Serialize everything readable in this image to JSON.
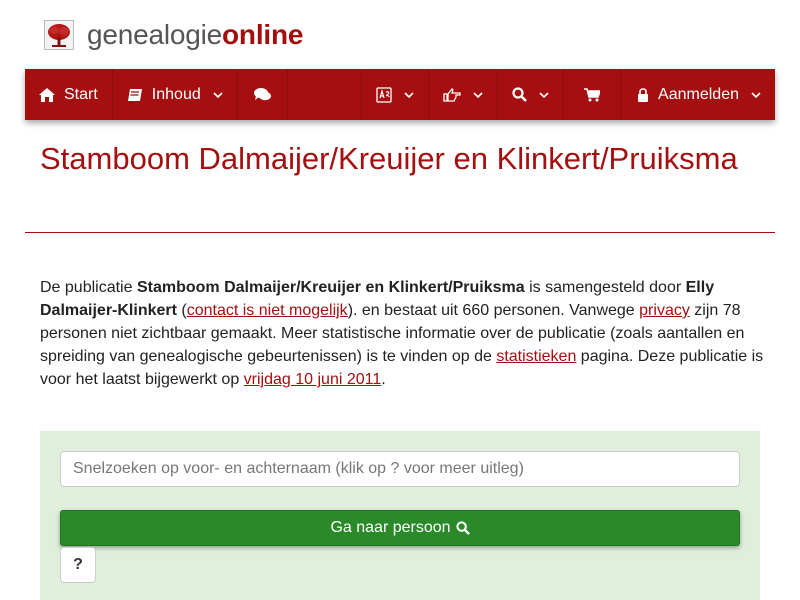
{
  "header": {
    "logo_icon": "tree-icon",
    "logo_text_plain": "genealogie",
    "logo_text_bold": "online"
  },
  "nav": {
    "start_label": "Start",
    "inhoud_label": "Inhoud",
    "login_label": "Aanmelden",
    "icons": [
      "home-icon",
      "book-icon",
      "comments-icon",
      "language-icon",
      "hand-point-icon",
      "search-icon",
      "cart-icon",
      "lock-icon",
      "chevron-down-icon"
    ]
  },
  "page": {
    "title": "Stamboom Dalmaijer/Kreuijer en Klinkert/Pruiksma"
  },
  "intro": {
    "t1": "De publicatie ",
    "pub_name": "Stamboom Dalmaijer/Kreuijer en Klinkert/Pruiksma",
    "t2": " is samengesteld door ",
    "author": "Elly Dalmaijer-Klinkert",
    "t3": " (",
    "contact_link": "contact is niet mogelijk",
    "t4": "). en bestaat uit 660 personen. Vanwege ",
    "privacy_link": "privacy",
    "t5": " zijn 78 personen niet zichtbaar gemaakt. Meer statistische informatie over de publicatie (zoals aantallen en spreiding van genealogische gebeurtenissen) is te vinden op de ",
    "stats_link": "statistieken",
    "t6": " pagina. Deze publicatie is voor het laatst bijgewerkt op ",
    "date_link": "vrijdag 10 juni 2011",
    "t7": "."
  },
  "search": {
    "placeholder": "Snelzoeken op voor- en achternaam (klik op ? voor meer uitleg)",
    "value": "",
    "go_label": "Ga naar persoon",
    "help_label": "?"
  },
  "colors": {
    "brand": "#a50f0f",
    "panel": "#dfefdb",
    "go_button": "#2a8a2a"
  }
}
